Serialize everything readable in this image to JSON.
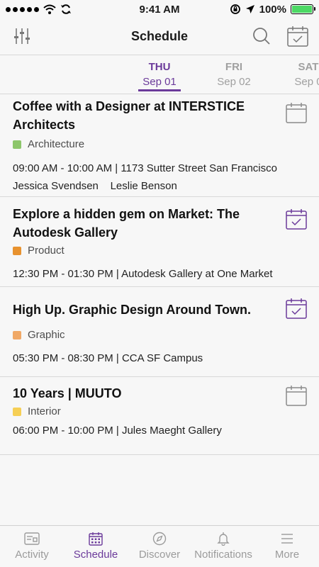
{
  "status": {
    "time": "9:41 AM",
    "battery": "100%",
    "battery_level": 1.0
  },
  "nav": {
    "title": "Schedule"
  },
  "dates": [
    {
      "dow": "THU",
      "date": "Sep 01",
      "active": true
    },
    {
      "dow": "FRI",
      "date": "Sep 02",
      "active": false
    },
    {
      "dow": "SAT",
      "date": "Sep 0",
      "active": false
    }
  ],
  "events": [
    {
      "title": "Coffee with a Designer at INTERSTICE Architects",
      "tag": "Architecture",
      "tag_color": "#8dc66b",
      "time": "09:00 AM - 10:00 AM | 1173 Sutter Street San Francisco",
      "people": "Jessica Svendsen    Leslie Benson",
      "added": false
    },
    {
      "title": "Explore a hidden gem on Market: The Autodesk Gallery",
      "tag": "Product",
      "tag_color": "#e8922f",
      "time": "12:30 PM - 01:30 PM | Autodesk Gallery at One Market",
      "added": true
    },
    {
      "title": "High Up. Graphic Design Around Town.",
      "tag": "Graphic",
      "tag_color": "#f0a866",
      "time": "05:30 PM - 08:30 PM | CCA SF Campus",
      "added": true
    },
    {
      "title": "10 Years | MUUTO",
      "tag": "Interior",
      "tag_color": "#f6cf55",
      "time": "06:00 PM - 10:00 PM | Jules Maeght Gallery",
      "added": false
    }
  ],
  "tabs": [
    {
      "label": "Activity",
      "icon": "activity-icon",
      "active": false
    },
    {
      "label": "Schedule",
      "icon": "calendar-icon",
      "active": true
    },
    {
      "label": "Discover",
      "icon": "compass-icon",
      "active": false
    },
    {
      "label": "Notifications",
      "icon": "bell-icon",
      "active": false
    },
    {
      "label": "More",
      "icon": "menu-icon",
      "active": false
    }
  ],
  "colors": {
    "accent": "#6b3a9a",
    "divider": "#d8d8d8",
    "inactive": "#9b9b9b"
  }
}
